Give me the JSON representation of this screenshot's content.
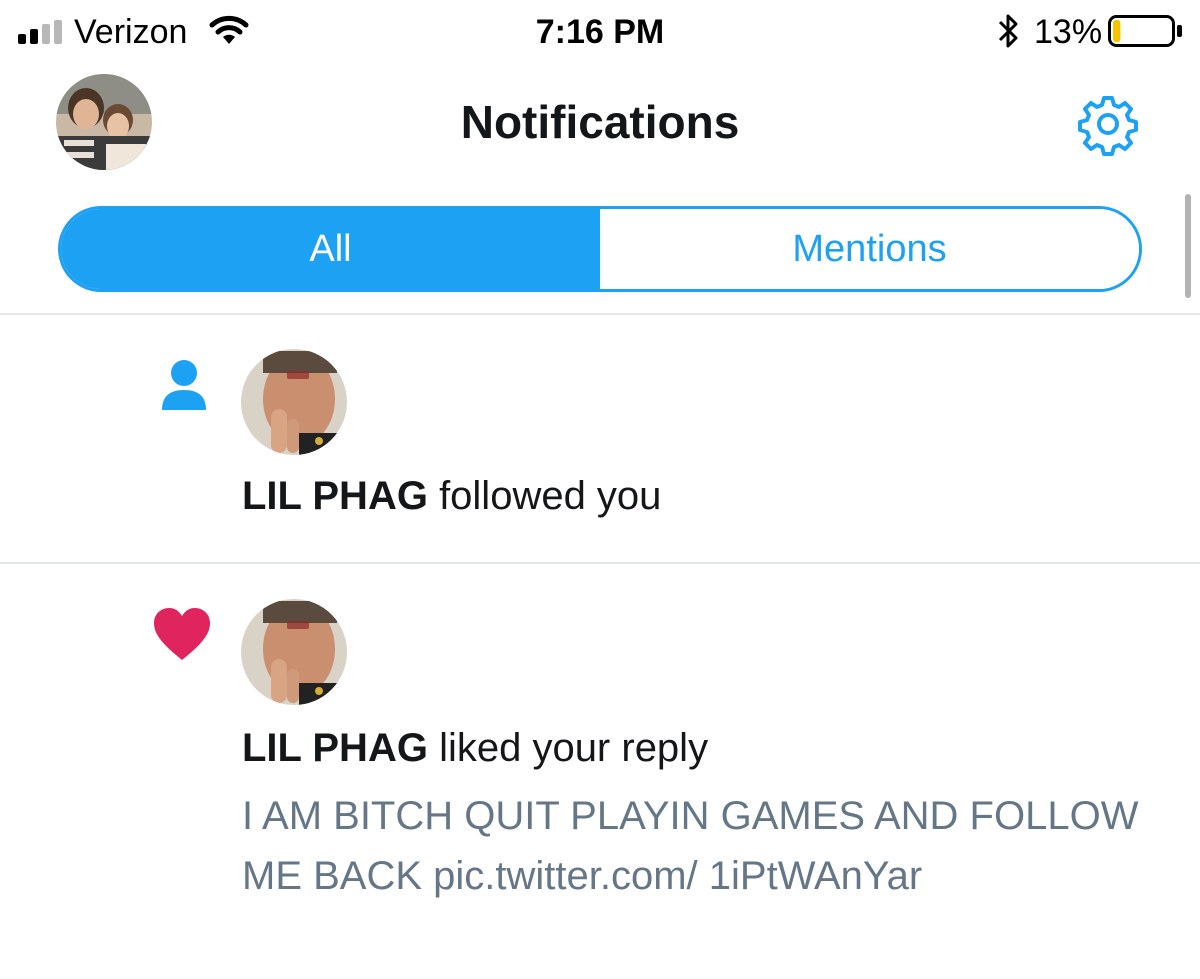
{
  "status_bar": {
    "carrier": "Verizon",
    "time": "7:16 PM",
    "battery_percent": "13%",
    "battery_level": 0.13,
    "battery_color": "#f5c400",
    "icons": [
      "signal-icon",
      "wifi-icon",
      "bluetooth-icon",
      "battery-icon"
    ]
  },
  "header": {
    "title": "Notifications",
    "settings_icon": "gear-icon"
  },
  "tabs": [
    {
      "label": "All",
      "active": true
    },
    {
      "label": "Mentions",
      "active": false
    }
  ],
  "colors": {
    "accent": "#1da1f2",
    "like": "#e0245e",
    "text": "#14171a",
    "secondary": "#657786"
  },
  "notifications": [
    {
      "type_icon": "person-icon",
      "user": "LIL PHAG",
      "action": "followed you"
    },
    {
      "type_icon": "heart-icon",
      "user": "LIL PHAG",
      "action": "liked your reply",
      "quote": "I AM BITCH QUIT PLAYIN GAMES AND FOLLOW ME BACK pic.twitter.com/ 1iPtWAnYar"
    }
  ]
}
